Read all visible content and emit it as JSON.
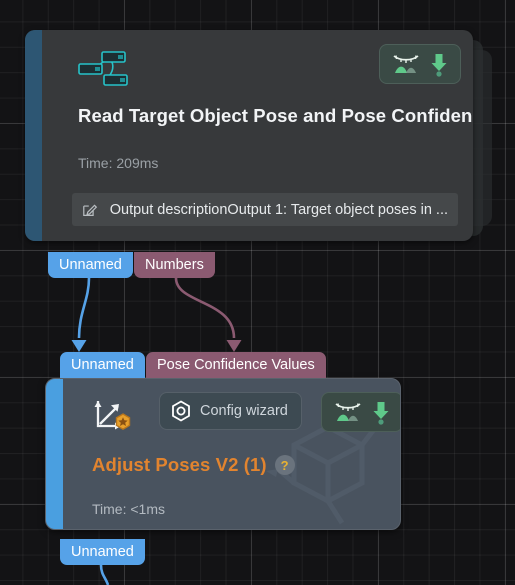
{
  "canvas": {
    "background_color": "#131315",
    "grid_minor_color": "#232325",
    "grid_major_color": "#343436"
  },
  "nodes": [
    {
      "id": "read-target-object-pose",
      "title": "Read Target Object Pose and Pose Confidence",
      "title_color": "#f2f4f6",
      "help_badge": "?",
      "time_label": "Time: 209ms",
      "accent_color": "#2d5673",
      "body_color": "#37393b",
      "icon": "node-tree-icon",
      "description": {
        "icon": "edit-pencil-icon",
        "text": "Output descriptionOutput 1: Target object poses in ..."
      },
      "toolbar": {
        "landscape_icon": "landscape-image-icon",
        "download_icon": "download-arrow-icon"
      },
      "stacked": true
    },
    {
      "id": "adjust-poses-v2",
      "title": "Adjust Poses V2 (1)",
      "title_color": "#e2842f",
      "help_badge": "?",
      "time_label": "Time: <1ms",
      "accent_color": "#4a9fe0",
      "body_color": "#49535f",
      "icon": "coordinate-axes-icon",
      "icon_badge": "orange-gem-badge",
      "config_wizard": {
        "label": "Config wizard",
        "icon": "hexagon-target-icon"
      },
      "toolbar": {
        "landscape_icon": "landscape-image-icon",
        "download_icon": "download-arrow-icon"
      },
      "watermark": "cube-axes-watermark",
      "selected": true
    }
  ],
  "ports": {
    "read_outputs": [
      {
        "label": "Unnamed",
        "color": "#56a2e8",
        "type": "blue"
      },
      {
        "label": "Numbers",
        "color": "#8b5a71",
        "type": "mauve"
      }
    ],
    "adjust_inputs": [
      {
        "label": "Unnamed",
        "color": "#56a2e8",
        "type": "blue"
      },
      {
        "label": "Pose Confidence Values",
        "color": "#8b5a71",
        "type": "mauve"
      }
    ],
    "adjust_outputs": [
      {
        "label": "Unnamed",
        "color": "#56a2e8",
        "type": "blue"
      }
    ]
  },
  "wires": [
    {
      "name": "unnamed-to-unnamed",
      "color": "#56a2e8"
    },
    {
      "name": "numbers-to-pose-confidence-values",
      "color": "#8b5a71"
    },
    {
      "name": "adjust-output-downstream",
      "color": "#56a2e8"
    }
  ],
  "colors": {
    "blue_port": "#56a2e8",
    "mauve_port": "#8b5a71",
    "orange_title": "#e2842f",
    "green_icon": "#5fc98a",
    "cyan_icon": "#27c3c9"
  }
}
